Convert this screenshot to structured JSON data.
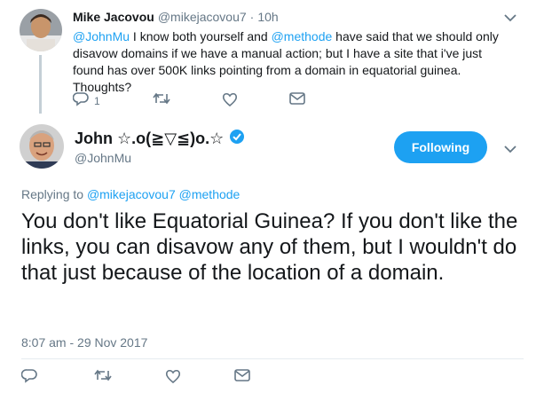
{
  "parent_tweet": {
    "author_name": "Mike Jacovou",
    "author_handle": "@mikejacovou7",
    "separator": "·",
    "time": "10h",
    "text_parts": [
      {
        "type": "mention",
        "text": "@JohnMu"
      },
      {
        "type": "text",
        "text": " I know both yourself and "
      },
      {
        "type": "mention",
        "text": "@methode"
      },
      {
        "type": "text",
        "text": " have said that we should only disavow domains if we have a manual action; but I have a site that i've just found has over 500K links pointing from a domain in equatorial guinea. Thoughts?"
      }
    ],
    "reply_count": "1",
    "retweet_count": "",
    "like_count": "",
    "icons": [
      "reply-icon",
      "retweet-icon",
      "like-icon",
      "message-icon",
      "chevron-down-icon"
    ]
  },
  "main_tweet": {
    "author_name": "John ☆.o(≧▽≦)o.☆",
    "verified": true,
    "author_handle": "@JohnMu",
    "follow_button_label": "Following",
    "replying_prefix": "Replying to",
    "replying_to": [
      "@mikejacovou7",
      "@methode"
    ],
    "text": "You don't like Equatorial Guinea? If you don't like the links, you can disavow any of them, but I wouldn't do that just because of the location of a domain.",
    "timestamp": "8:07 am - 29 Nov 2017",
    "icons": [
      "reply-icon",
      "retweet-icon",
      "like-icon",
      "message-icon",
      "chevron-down-icon",
      "verified-badge-icon"
    ]
  },
  "colors": {
    "accent": "#1da1f2",
    "text_primary": "#14171a",
    "text_secondary": "#657786",
    "thread_line": "#c4cfd6"
  }
}
